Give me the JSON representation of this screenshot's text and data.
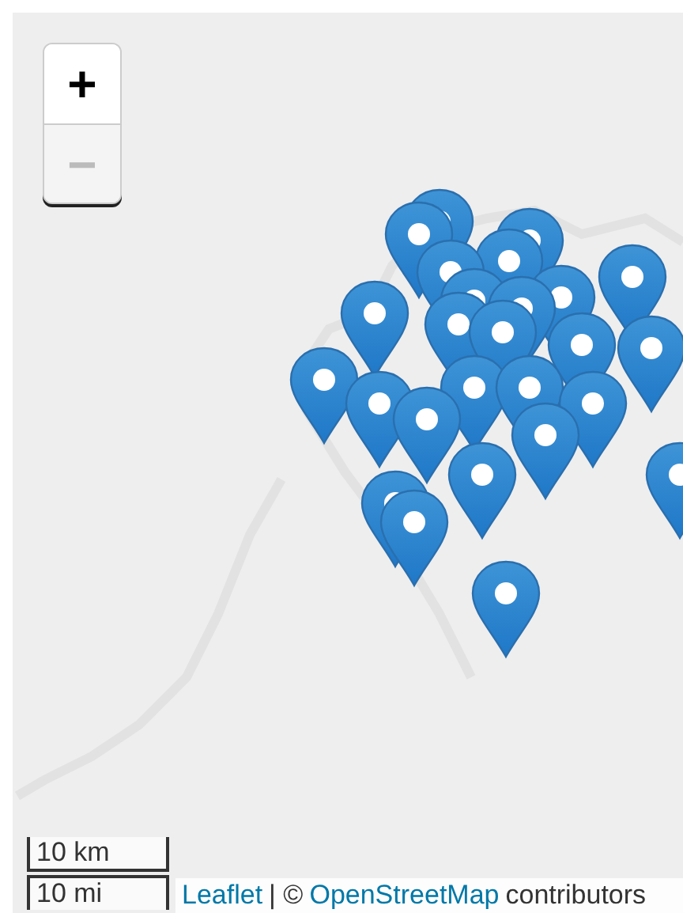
{
  "zoom_controls": [
    {
      "label": "+",
      "disabled": false
    },
    {
      "label": "−",
      "disabled": true
    }
  ],
  "scale": [
    "10 km",
    "10 mi"
  ],
  "attribution": {
    "link": "Leaflet",
    "separator": "| ©",
    "source_link": "OpenStreetMap",
    "text": "contributors"
  }
}
